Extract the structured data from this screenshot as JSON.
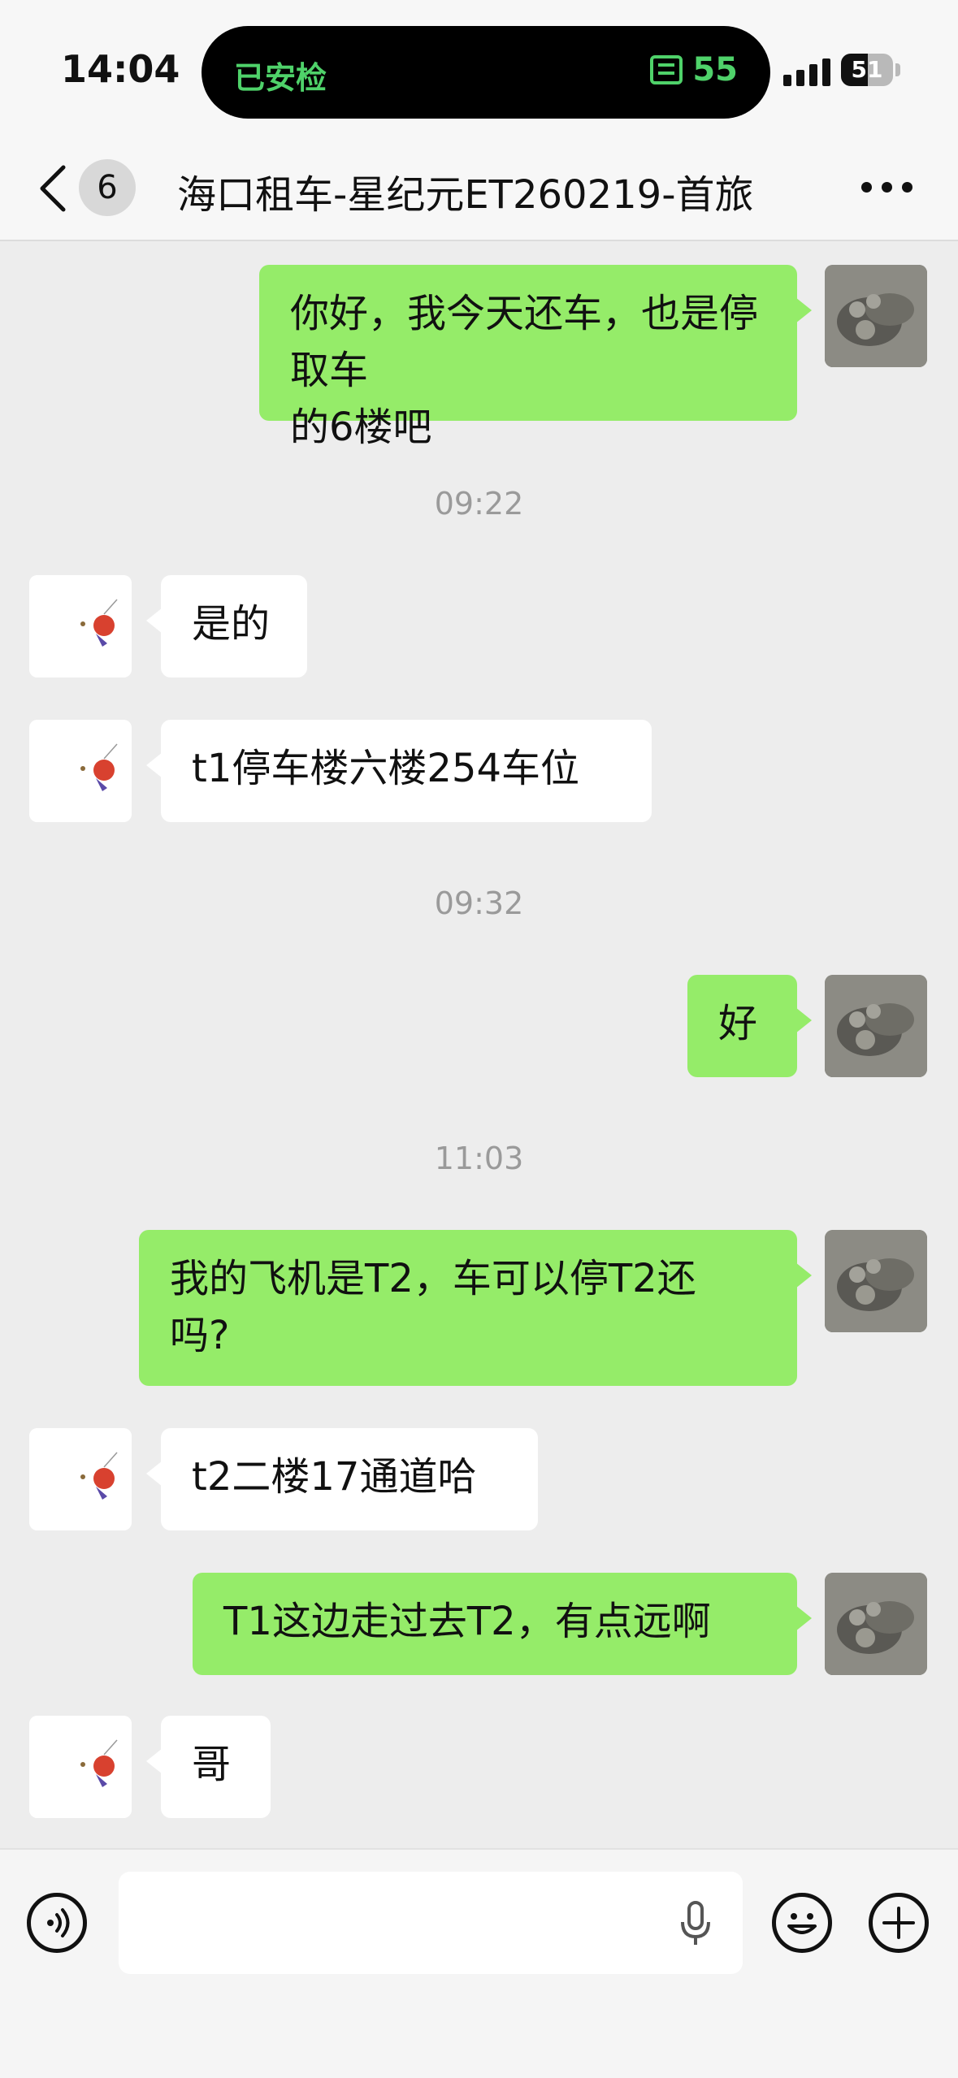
{
  "status_bar": {
    "time": "14:04",
    "island_left": "已安检",
    "island_right_icon": "ticket-icon",
    "island_right": "55",
    "battery": "51",
    "battery_level": 0.51
  },
  "nav": {
    "back_icon": "chevron-left-icon",
    "unread_count": "6",
    "title": "海口租车-星纪元ET260219-首旅",
    "more_icon": "more-horizontal-icon"
  },
  "messages": [
    {
      "side": "me",
      "text_line1": "你好，我今天还车，也是停取车",
      "text_line2": "的6楼吧"
    },
    {
      "type": "time",
      "text": "09:22"
    },
    {
      "side": "other",
      "text": "是的"
    },
    {
      "side": "other",
      "text": "t1停车楼六楼254车位"
    },
    {
      "type": "time",
      "text": "09:32"
    },
    {
      "side": "me",
      "text": "好"
    },
    {
      "type": "time",
      "text": "11:03"
    },
    {
      "side": "me",
      "text_line1": "我的飞机是T2，车可以停T2还",
      "text_line2": "吗?"
    },
    {
      "side": "other",
      "text": "t2二楼17通道哈"
    },
    {
      "side": "me",
      "text": "T1这边走过去T2，有点远啊"
    },
    {
      "side": "other",
      "text": "哥"
    }
  ],
  "input_bar": {
    "voice_icon": "voice-icon",
    "placeholder": "",
    "mic_icon": "microphone-icon",
    "emoji_icon": "emoji-icon",
    "plus_icon": "plus-icon"
  },
  "colors": {
    "my_bubble": "#95ec69",
    "other_bubble": "#ffffff",
    "background": "#ededed",
    "island_text": "#4fd26a"
  }
}
